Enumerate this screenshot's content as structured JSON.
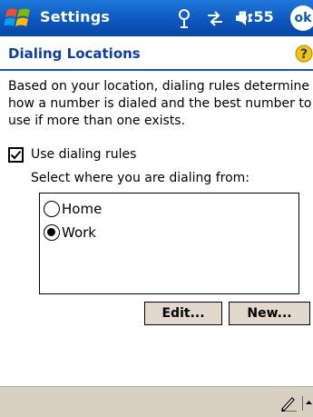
{
  "title_bar": {
    "app_title": "Settings",
    "clock": "5:55",
    "ok_label": "ok",
    "icons": [
      "windows-flag-icon",
      "signal-icon",
      "connectivity-icon",
      "volume-icon"
    ]
  },
  "page": {
    "title": "Dialing Locations",
    "help_icon": "help-icon",
    "description": "Based on your location, dialing rules determine how a number is dialed and the best number to use if more than one exists."
  },
  "dialing_rules": {
    "checkbox_label": "Use dialing rules",
    "checked": true,
    "select_prompt": "Select where you are dialing from:",
    "locations": [
      {
        "label": "Home",
        "selected": false
      },
      {
        "label": "Work",
        "selected": true
      }
    ]
  },
  "buttons": {
    "edit_label": "Edit...",
    "new_label": "New..."
  },
  "colors": {
    "title_bar": "#0c58c0",
    "page_title": "#0c3fa8",
    "button_face": "#e2d9cc",
    "bottom_bar": "#d8cfc2"
  },
  "bottom_bar": {
    "icons": [
      "input-panel-icon",
      "input-arrow-icon"
    ]
  }
}
